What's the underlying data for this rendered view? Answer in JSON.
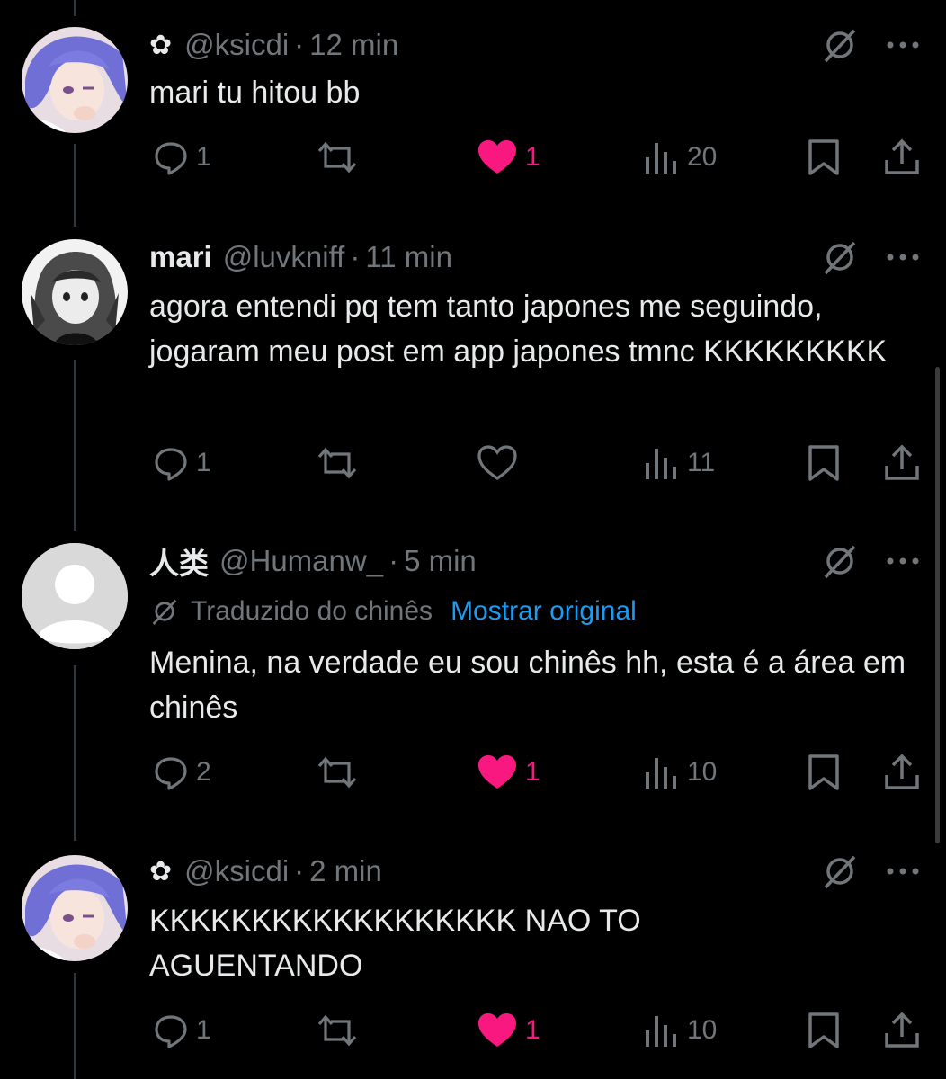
{
  "tweets": [
    {
      "flower": "✿",
      "display_name": "",
      "handle": "@ksicdi",
      "sep": "·",
      "time": "12 min",
      "text": "mari tu hitou bb",
      "translation": null,
      "avatar": "anime-blue-hair",
      "replies": "1",
      "retweets": "",
      "likes": "1",
      "liked": true,
      "views": "20"
    },
    {
      "flower": "",
      "display_name": "mari",
      "handle": "@luvkniff",
      "sep": "·",
      "time": "11 min",
      "text": "agora entendi pq tem tanto japones me seguindo, jogaram meu post em app japones tmnc KKKKKKKKK",
      "translation": null,
      "avatar": "anime-grayscale",
      "replies": "1",
      "retweets": "",
      "likes": "",
      "liked": false,
      "views": "11"
    },
    {
      "flower": "",
      "display_name": "人类",
      "handle": "@Humanw_",
      "sep": "·",
      "time": "5 min",
      "translation": {
        "label": "Traduzido do chinês",
        "link": "Mostrar original"
      },
      "text": "Menina, na verdade eu sou chinês hh, esta é a área em chinês",
      "avatar": "default",
      "replies": "2",
      "retweets": "",
      "likes": "1",
      "liked": true,
      "views": "10"
    },
    {
      "flower": "✿",
      "display_name": "",
      "handle": "@ksicdi",
      "sep": "·",
      "time": "2 min",
      "text": "KKKKKKKKKKKKKKKKKK NAO TO AGUENTANDO",
      "translation": null,
      "avatar": "anime-blue-hair",
      "replies": "1",
      "retweets": "",
      "likes": "1",
      "liked": true,
      "views": "10"
    }
  ],
  "colors": {
    "like": "#f91880",
    "link": "#1d9bf0",
    "muted": "#71767b",
    "text": "#e7e9ea"
  },
  "icons": [
    "reply-icon",
    "retweet-icon",
    "heart-icon",
    "views-icon",
    "bookmark-icon",
    "share-icon",
    "grok-icon",
    "more-icon"
  ]
}
